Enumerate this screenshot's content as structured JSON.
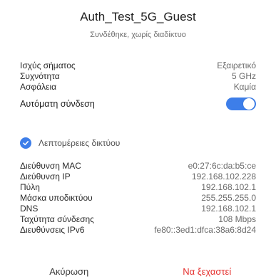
{
  "dialog": {
    "title": "Auth_Test_5G_Guest",
    "subtitle": "Συνδέθηκε, χωρίς διαδίκτυο"
  },
  "basic_info": [
    {
      "label": "Ισχύς σήματος",
      "value": "Εξαιρετικό"
    },
    {
      "label": "Συχνότητα",
      "value": "5 GHz"
    },
    {
      "label": "Ασφάλεια",
      "value": "Καμία"
    }
  ],
  "auto_connect": {
    "label": "Αυτόματη σύνδεση",
    "enabled": true
  },
  "advanced": {
    "label": "Λεπτομέρειες δικτύου",
    "checked": true
  },
  "details": [
    {
      "label": "Διεύθυνση MAC",
      "value": "e0:27:6c:da:b5:ce"
    },
    {
      "label": "Διεύθυνση IP",
      "value": "192.168.102.228"
    },
    {
      "label": "Πύλη",
      "value": "192.168.102.1"
    },
    {
      "label": "Μάσκα υποδικτύου",
      "value": "255.255.255.0"
    },
    {
      "label": "DNS",
      "value": "192.168.102.1"
    },
    {
      "label": "Ταχύτητα σύνδεσης",
      "value": "108 Mbps"
    },
    {
      "label": "Διευθύνσεις IPv6",
      "value": "fe80::3ed1:dfca:38a6:8d24"
    }
  ],
  "buttons": {
    "cancel": "Ακύρωση",
    "forget": "Να ξεχαστεί"
  },
  "colors": {
    "accent": "#3d7ee9",
    "danger": "#e5312f"
  }
}
